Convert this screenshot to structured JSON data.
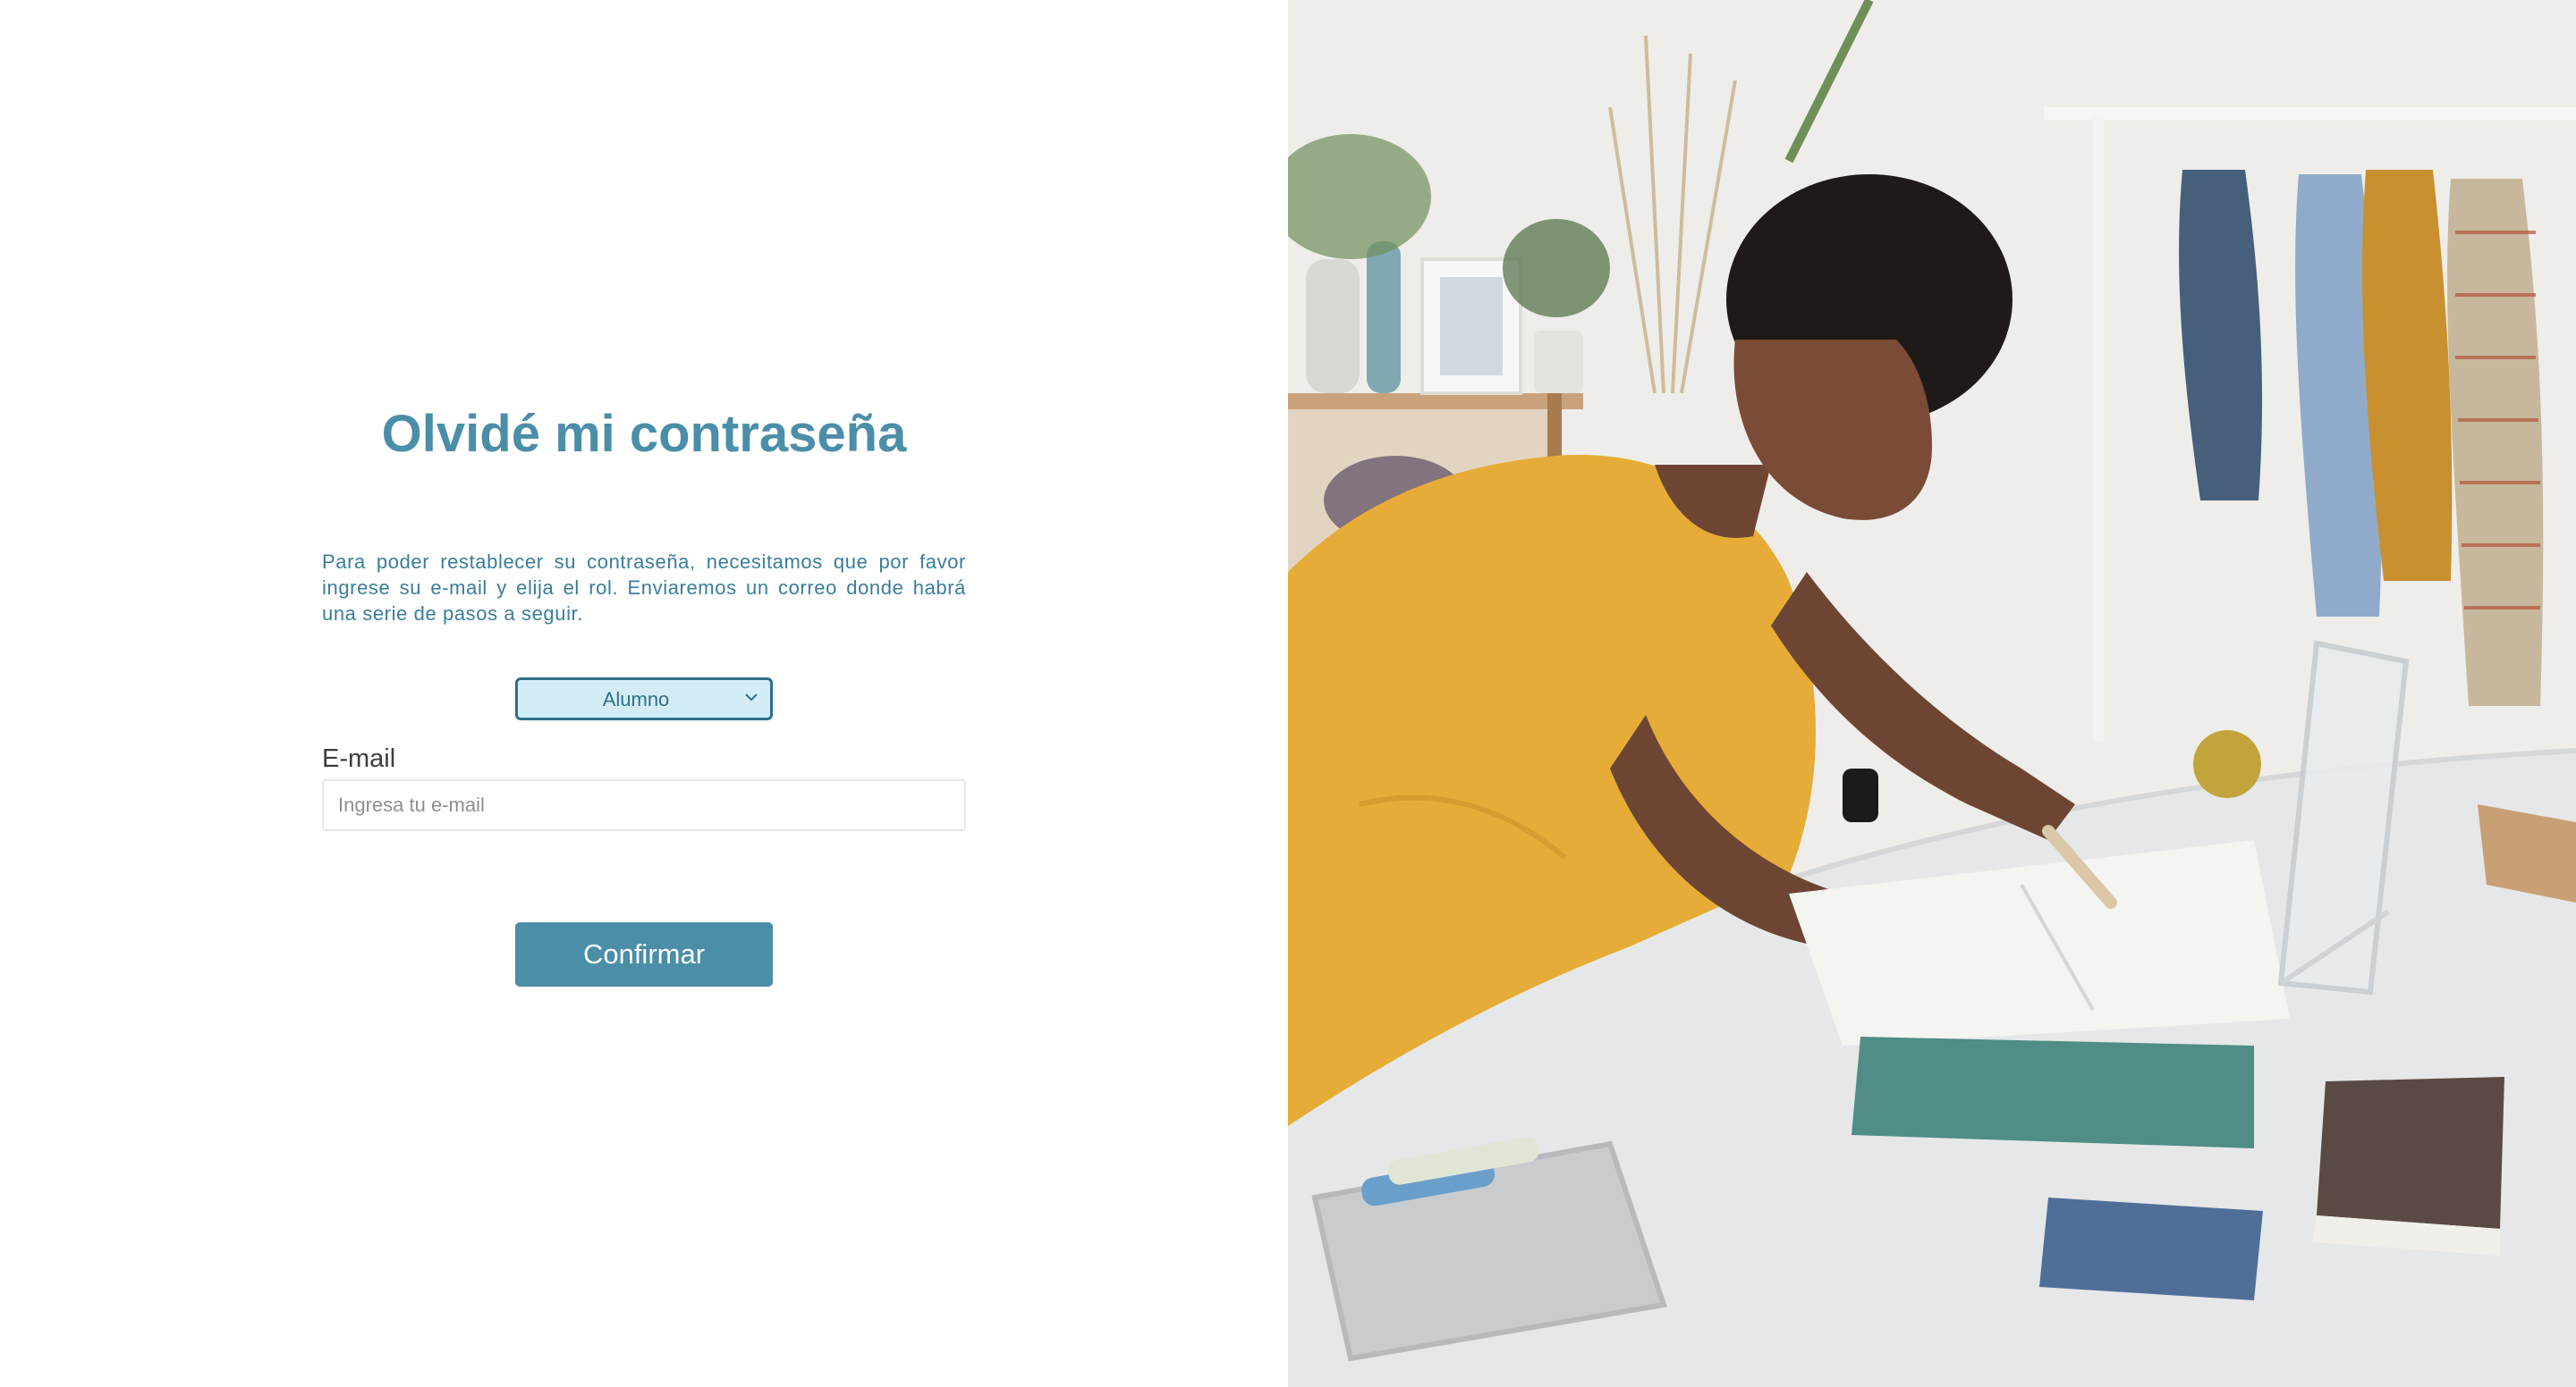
{
  "form": {
    "title": "Olvidé mi contraseña",
    "description": "Para poder restablecer su contraseña, necesitamos que por favor ingrese su e-mail y elija el rol. Enviaremos un correo donde habrá una serie de pasos a seguir.",
    "role_select": {
      "selected": "Alumno"
    },
    "email": {
      "label": "E-mail",
      "placeholder": "Ingresa tu e-mail",
      "value": ""
    },
    "confirm_label": "Confirmar"
  },
  "colors": {
    "accent": "#4a8ea8",
    "select_bg": "#d3edf7",
    "select_border": "#2f6f8a",
    "label_text": "#3d3d3d"
  },
  "icons": {
    "select_chevron": "chevron-down-icon"
  }
}
